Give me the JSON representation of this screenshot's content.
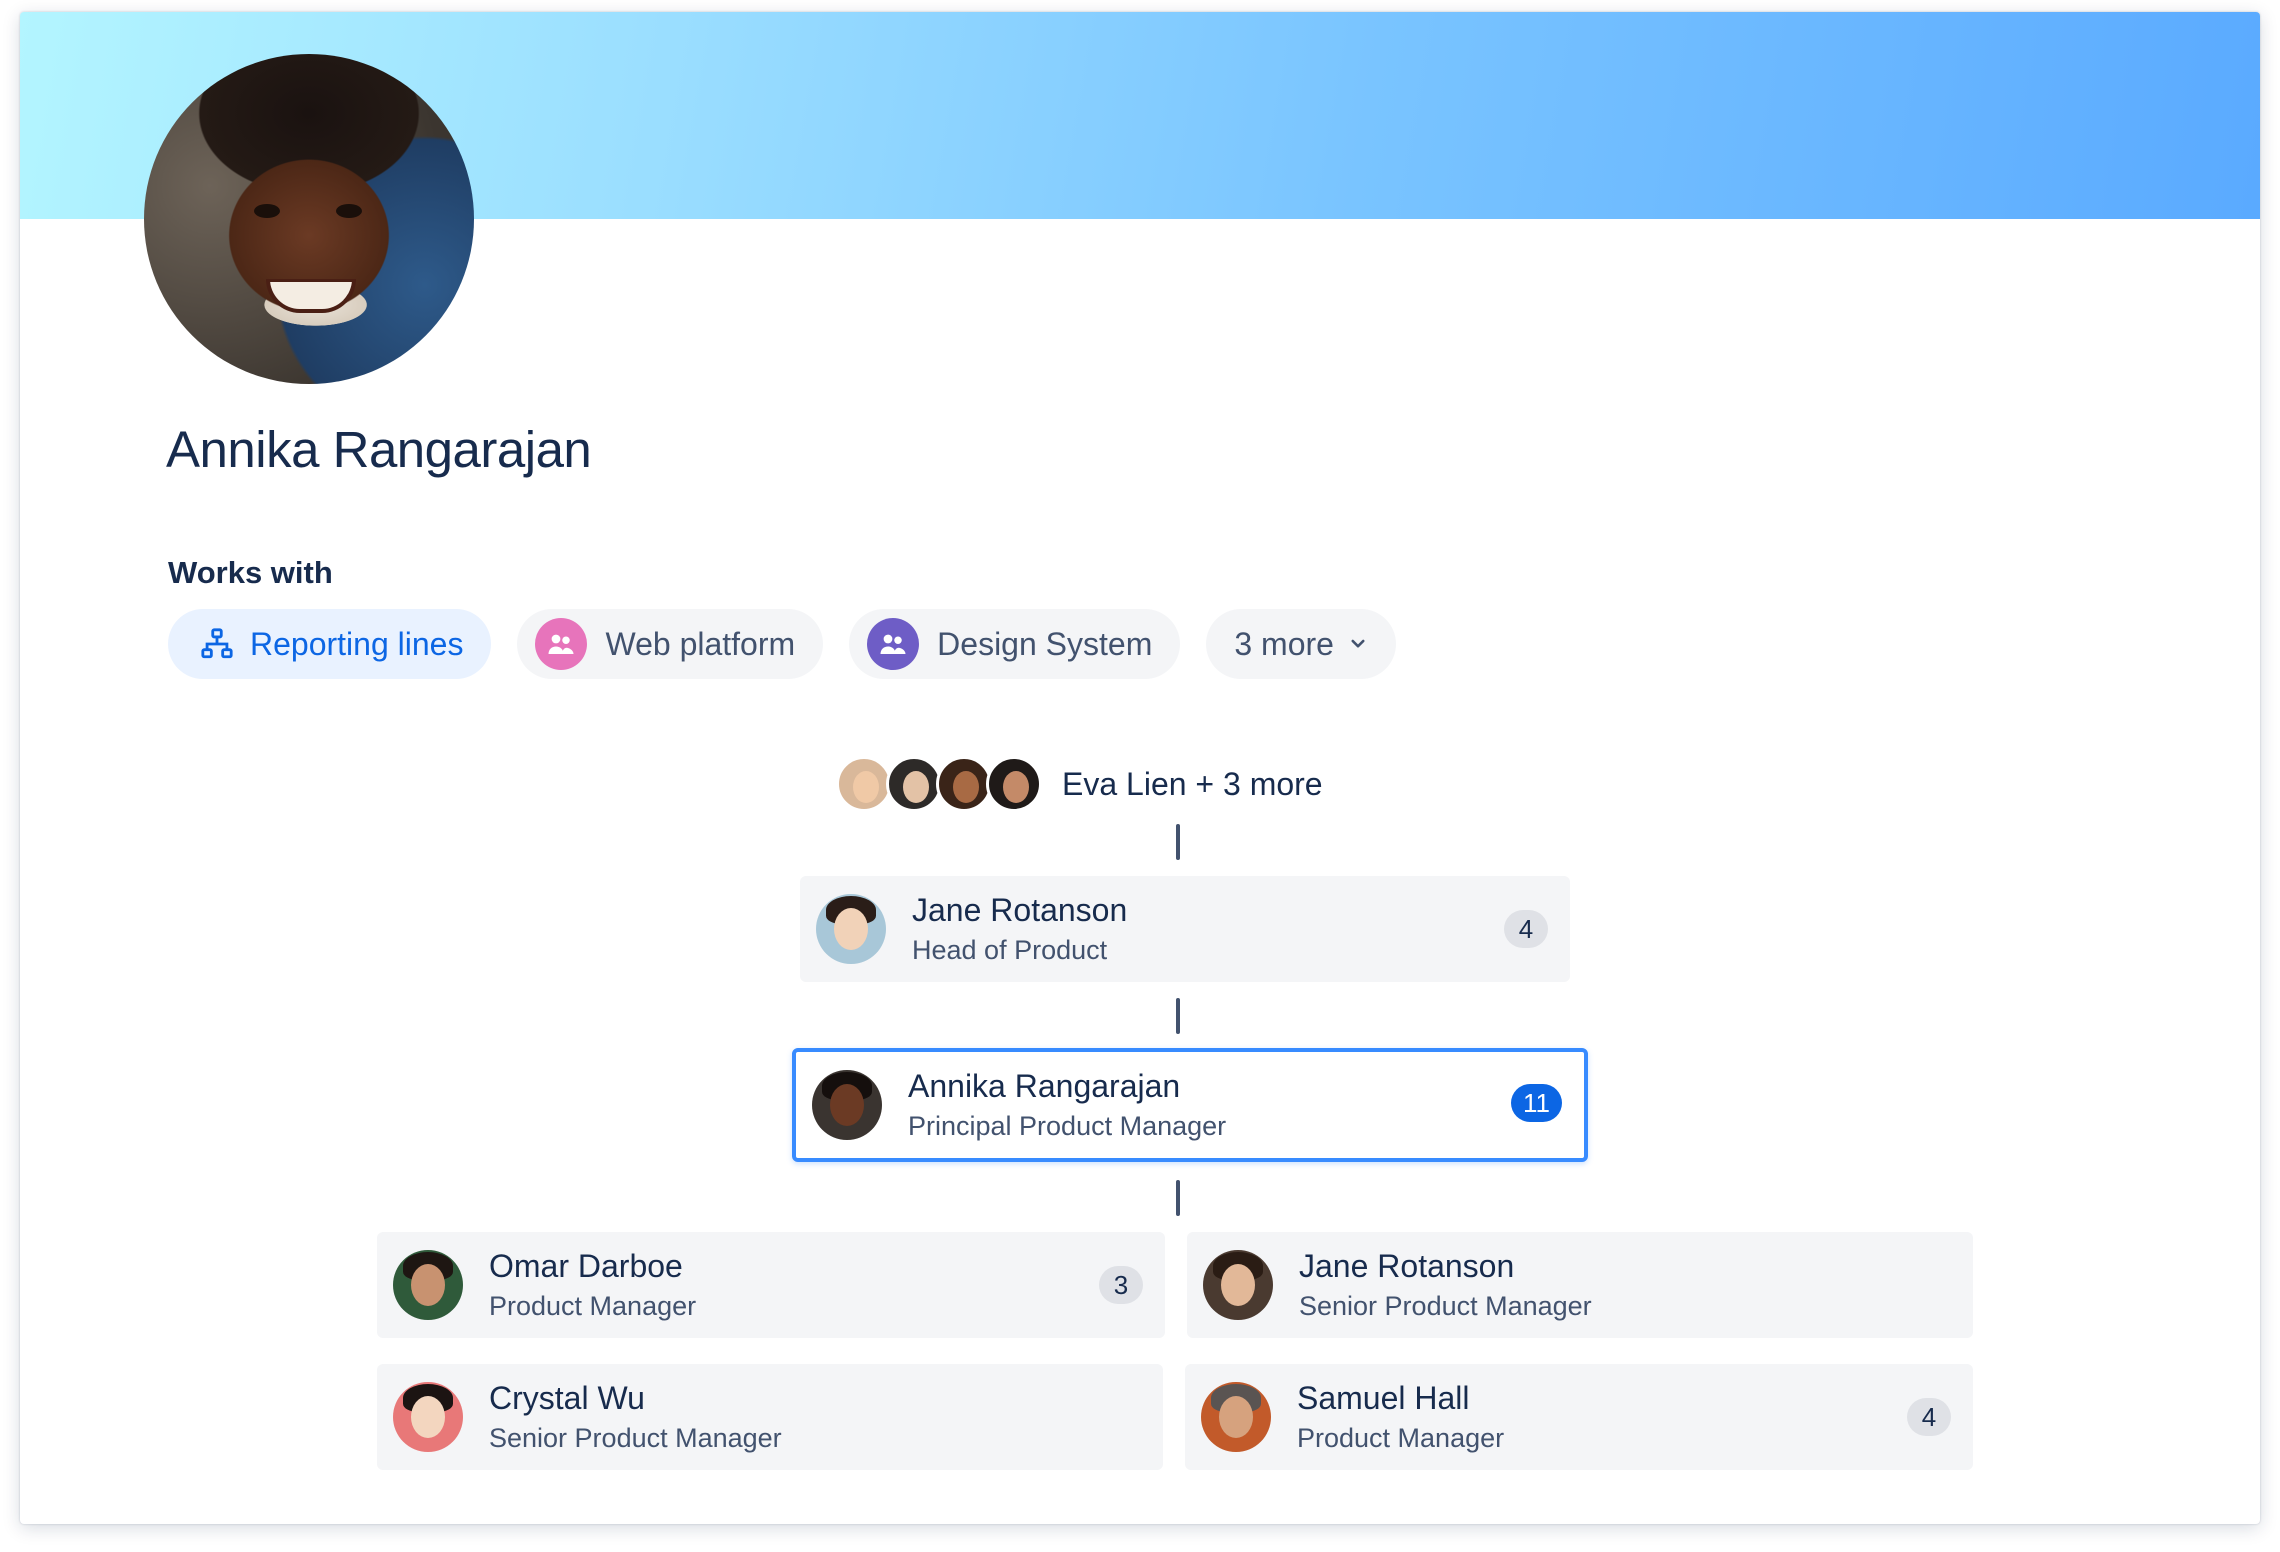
{
  "profile": {
    "name": "Annika Rangarajan"
  },
  "works_with": {
    "heading": "Works with",
    "chips": [
      {
        "label": "Reporting lines",
        "icon": "org-chart-icon",
        "active": true
      },
      {
        "label": "Web platform",
        "icon": "team-icon",
        "color": "#E774BB"
      },
      {
        "label": "Design System",
        "icon": "team-icon",
        "color": "#6E5DC6"
      },
      {
        "label": "3 more",
        "icon": "chevron-down-icon"
      }
    ]
  },
  "org": {
    "managers_label": "Eva Lien + 3 more",
    "manager": {
      "name": "Jane Rotanson",
      "role": "Head of Product",
      "count": "4"
    },
    "current": {
      "name": "Annika Rangarajan",
      "role": "Principal Product Manager",
      "count": "11"
    },
    "reports": [
      {
        "name": "Omar Darboe",
        "role": "Product Manager",
        "count": "3"
      },
      {
        "name": "Jane Rotanson",
        "role": "Senior Product Manager",
        "count": ""
      },
      {
        "name": "Crystal Wu",
        "role": "Senior Product Manager",
        "count": ""
      },
      {
        "name": "Samuel Hall",
        "role": "Product Manager",
        "count": "4"
      }
    ]
  },
  "colors": {
    "accent": "#0C66E4",
    "current_border": "#388BFF",
    "text": "#172B4D",
    "subtle_text": "#42526E"
  }
}
